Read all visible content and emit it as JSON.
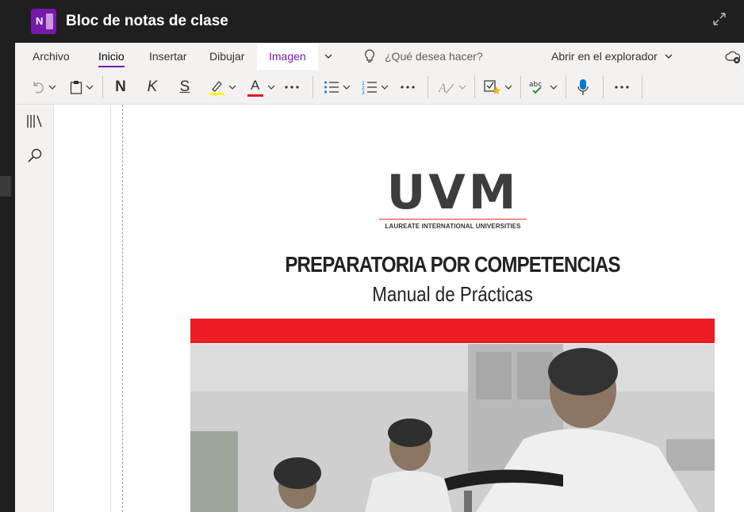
{
  "app": {
    "logo_letter": "N",
    "title": "Bloc de notas de clase",
    "accent": "#7719aa"
  },
  "ribbon": {
    "tabs": [
      {
        "label": "Archivo",
        "active": false
      },
      {
        "label": "Inicio",
        "active": true
      },
      {
        "label": "Insertar",
        "active": false
      },
      {
        "label": "Dibujar",
        "active": false
      },
      {
        "label": "Imagen",
        "active": false,
        "contextual": true
      }
    ],
    "tell_me_placeholder": "¿Qué desea hacer?",
    "open_in_label": "Abrir en el explorador",
    "format": {
      "bold": "N",
      "italic": "K",
      "underline": "S",
      "font_color_letter": "A"
    },
    "highlight_color": "#ffff00",
    "font_color": "#e81123"
  },
  "sidebar": {
    "icons": [
      "notebooks-icon",
      "search-icon"
    ]
  },
  "document": {
    "logo_text": "UVM",
    "logo_subtitle": "LAUREATE INTERNATIONAL UNIVERSITIES",
    "title": "PREPARATORIA POR COMPETENCIAS",
    "subtitle": "Manual de Prácticas",
    "band_color": "#ed1c24"
  }
}
